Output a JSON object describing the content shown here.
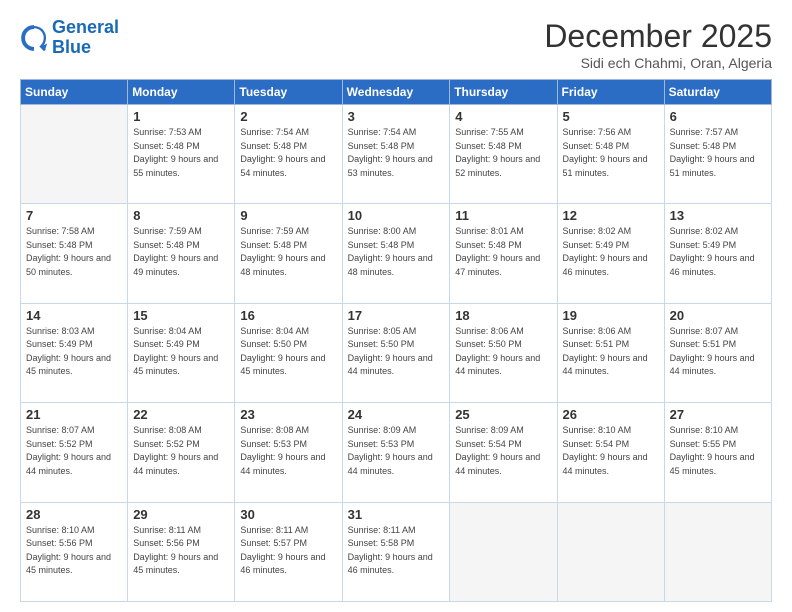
{
  "header": {
    "logo_general": "General",
    "logo_blue": "Blue",
    "title": "December 2025",
    "subtitle": "Sidi ech Chahmi, Oran, Algeria"
  },
  "calendar": {
    "headers": [
      "Sunday",
      "Monday",
      "Tuesday",
      "Wednesday",
      "Thursday",
      "Friday",
      "Saturday"
    ],
    "rows": [
      [
        {
          "day": "",
          "sunrise": "",
          "sunset": "",
          "daylight": "",
          "empty": true
        },
        {
          "day": "1",
          "sunrise": "Sunrise: 7:53 AM",
          "sunset": "Sunset: 5:48 PM",
          "daylight": "Daylight: 9 hours and 55 minutes."
        },
        {
          "day": "2",
          "sunrise": "Sunrise: 7:54 AM",
          "sunset": "Sunset: 5:48 PM",
          "daylight": "Daylight: 9 hours and 54 minutes."
        },
        {
          "day": "3",
          "sunrise": "Sunrise: 7:54 AM",
          "sunset": "Sunset: 5:48 PM",
          "daylight": "Daylight: 9 hours and 53 minutes."
        },
        {
          "day": "4",
          "sunrise": "Sunrise: 7:55 AM",
          "sunset": "Sunset: 5:48 PM",
          "daylight": "Daylight: 9 hours and 52 minutes."
        },
        {
          "day": "5",
          "sunrise": "Sunrise: 7:56 AM",
          "sunset": "Sunset: 5:48 PM",
          "daylight": "Daylight: 9 hours and 51 minutes."
        },
        {
          "day": "6",
          "sunrise": "Sunrise: 7:57 AM",
          "sunset": "Sunset: 5:48 PM",
          "daylight": "Daylight: 9 hours and 51 minutes."
        }
      ],
      [
        {
          "day": "7",
          "sunrise": "Sunrise: 7:58 AM",
          "sunset": "Sunset: 5:48 PM",
          "daylight": "Daylight: 9 hours and 50 minutes."
        },
        {
          "day": "8",
          "sunrise": "Sunrise: 7:59 AM",
          "sunset": "Sunset: 5:48 PM",
          "daylight": "Daylight: 9 hours and 49 minutes."
        },
        {
          "day": "9",
          "sunrise": "Sunrise: 7:59 AM",
          "sunset": "Sunset: 5:48 PM",
          "daylight": "Daylight: 9 hours and 48 minutes."
        },
        {
          "day": "10",
          "sunrise": "Sunrise: 8:00 AM",
          "sunset": "Sunset: 5:48 PM",
          "daylight": "Daylight: 9 hours and 48 minutes."
        },
        {
          "day": "11",
          "sunrise": "Sunrise: 8:01 AM",
          "sunset": "Sunset: 5:48 PM",
          "daylight": "Daylight: 9 hours and 47 minutes."
        },
        {
          "day": "12",
          "sunrise": "Sunrise: 8:02 AM",
          "sunset": "Sunset: 5:49 PM",
          "daylight": "Daylight: 9 hours and 46 minutes."
        },
        {
          "day": "13",
          "sunrise": "Sunrise: 8:02 AM",
          "sunset": "Sunset: 5:49 PM",
          "daylight": "Daylight: 9 hours and 46 minutes."
        }
      ],
      [
        {
          "day": "14",
          "sunrise": "Sunrise: 8:03 AM",
          "sunset": "Sunset: 5:49 PM",
          "daylight": "Daylight: 9 hours and 45 minutes."
        },
        {
          "day": "15",
          "sunrise": "Sunrise: 8:04 AM",
          "sunset": "Sunset: 5:49 PM",
          "daylight": "Daylight: 9 hours and 45 minutes."
        },
        {
          "day": "16",
          "sunrise": "Sunrise: 8:04 AM",
          "sunset": "Sunset: 5:50 PM",
          "daylight": "Daylight: 9 hours and 45 minutes."
        },
        {
          "day": "17",
          "sunrise": "Sunrise: 8:05 AM",
          "sunset": "Sunset: 5:50 PM",
          "daylight": "Daylight: 9 hours and 44 minutes."
        },
        {
          "day": "18",
          "sunrise": "Sunrise: 8:06 AM",
          "sunset": "Sunset: 5:50 PM",
          "daylight": "Daylight: 9 hours and 44 minutes."
        },
        {
          "day": "19",
          "sunrise": "Sunrise: 8:06 AM",
          "sunset": "Sunset: 5:51 PM",
          "daylight": "Daylight: 9 hours and 44 minutes."
        },
        {
          "day": "20",
          "sunrise": "Sunrise: 8:07 AM",
          "sunset": "Sunset: 5:51 PM",
          "daylight": "Daylight: 9 hours and 44 minutes."
        }
      ],
      [
        {
          "day": "21",
          "sunrise": "Sunrise: 8:07 AM",
          "sunset": "Sunset: 5:52 PM",
          "daylight": "Daylight: 9 hours and 44 minutes."
        },
        {
          "day": "22",
          "sunrise": "Sunrise: 8:08 AM",
          "sunset": "Sunset: 5:52 PM",
          "daylight": "Daylight: 9 hours and 44 minutes."
        },
        {
          "day": "23",
          "sunrise": "Sunrise: 8:08 AM",
          "sunset": "Sunset: 5:53 PM",
          "daylight": "Daylight: 9 hours and 44 minutes."
        },
        {
          "day": "24",
          "sunrise": "Sunrise: 8:09 AM",
          "sunset": "Sunset: 5:53 PM",
          "daylight": "Daylight: 9 hours and 44 minutes."
        },
        {
          "day": "25",
          "sunrise": "Sunrise: 8:09 AM",
          "sunset": "Sunset: 5:54 PM",
          "daylight": "Daylight: 9 hours and 44 minutes."
        },
        {
          "day": "26",
          "sunrise": "Sunrise: 8:10 AM",
          "sunset": "Sunset: 5:54 PM",
          "daylight": "Daylight: 9 hours and 44 minutes."
        },
        {
          "day": "27",
          "sunrise": "Sunrise: 8:10 AM",
          "sunset": "Sunset: 5:55 PM",
          "daylight": "Daylight: 9 hours and 45 minutes."
        }
      ],
      [
        {
          "day": "28",
          "sunrise": "Sunrise: 8:10 AM",
          "sunset": "Sunset: 5:56 PM",
          "daylight": "Daylight: 9 hours and 45 minutes."
        },
        {
          "day": "29",
          "sunrise": "Sunrise: 8:11 AM",
          "sunset": "Sunset: 5:56 PM",
          "daylight": "Daylight: 9 hours and 45 minutes."
        },
        {
          "day": "30",
          "sunrise": "Sunrise: 8:11 AM",
          "sunset": "Sunset: 5:57 PM",
          "daylight": "Daylight: 9 hours and 46 minutes."
        },
        {
          "day": "31",
          "sunrise": "Sunrise: 8:11 AM",
          "sunset": "Sunset: 5:58 PM",
          "daylight": "Daylight: 9 hours and 46 minutes."
        },
        {
          "day": "",
          "sunrise": "",
          "sunset": "",
          "daylight": "",
          "empty": true
        },
        {
          "day": "",
          "sunrise": "",
          "sunset": "",
          "daylight": "",
          "empty": true
        },
        {
          "day": "",
          "sunrise": "",
          "sunset": "",
          "daylight": "",
          "empty": true
        }
      ]
    ]
  }
}
